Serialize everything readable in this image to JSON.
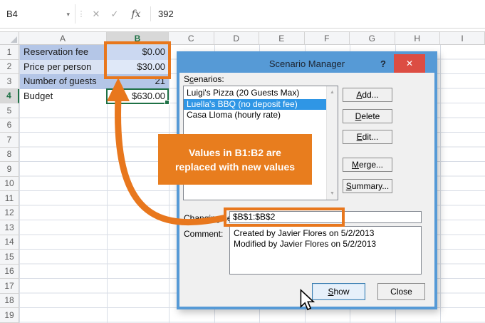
{
  "colors": {
    "accent_orange": "#e8771d",
    "callout_orange": "#e87d1e",
    "title_blue": "#569ad6",
    "selection_blue": "#2f96e5",
    "excel_green": "#1e7145",
    "close_red": "#dc4d43"
  },
  "formula_bar": {
    "name_box": "B4",
    "formula": "392",
    "fx_label": "fx"
  },
  "icons": {
    "dropdown": "▾",
    "handle": "⋮",
    "cancel": "✕",
    "enter": "✓",
    "scroll_up": "▲",
    "scroll_down": "▼",
    "help": "?",
    "dialog_close": "✕"
  },
  "sheet": {
    "column_headers": [
      "A",
      "B",
      "C",
      "D",
      "E",
      "F",
      "G",
      "H",
      "I"
    ],
    "selected_column": "B",
    "row_count": 19,
    "selected_row": 4,
    "cells": [
      {
        "row": 1,
        "label": "Reservation fee",
        "value": "$0.00",
        "label_bg": "#b4c6e7",
        "value_bg": "#cbd8f1"
      },
      {
        "row": 2,
        "label": "Price per person",
        "value": "$30.00",
        "label_bg": "#d9e2f3",
        "value_bg": "#dfe8f8"
      },
      {
        "row": 3,
        "label": "Number of guests",
        "value": "21",
        "label_bg": "#b4c6e7",
        "value_bg": "#b4c6e7"
      },
      {
        "row": 4,
        "label": "Budget",
        "value": "$630.00",
        "label_bg": "#ffffff",
        "value_bg": "#ffffff"
      }
    ]
  },
  "callout": {
    "line1": "Values in B1:B2 are",
    "line2": "replaced with new values"
  },
  "dialog": {
    "title": "Scenario Manager",
    "scenarios_label": {
      "label": "Scenarios:",
      "mnemonic": "c"
    },
    "scenarios": [
      "Luigi's Pizza (20 Guests Max)",
      "Luella's BBQ (no deposit fee)",
      "Casa Lloma (hourly rate)"
    ],
    "selected_scenario": "Luella's BBQ (no deposit fee)",
    "buttons": [
      {
        "label": "Add...",
        "mnemonic": "A"
      },
      {
        "label": "Delete",
        "mnemonic": "D"
      },
      {
        "label": "Edit...",
        "mnemonic": "E"
      },
      {
        "label": "Merge...",
        "mnemonic": "M"
      },
      {
        "label": "Summary...",
        "mnemonic": "S"
      }
    ],
    "changing_cells_label": "Changing cells:",
    "changing_cells_value": "$B$1:$B$2",
    "comment_label": "Comment:",
    "comment_lines": [
      "Created by Javier Flores on 5/2/2013",
      "Modified by Javier Flores on 5/2/2013"
    ],
    "show_button": {
      "label": "Show",
      "mnemonic": "S"
    },
    "close_button": {
      "label": "Close"
    }
  }
}
